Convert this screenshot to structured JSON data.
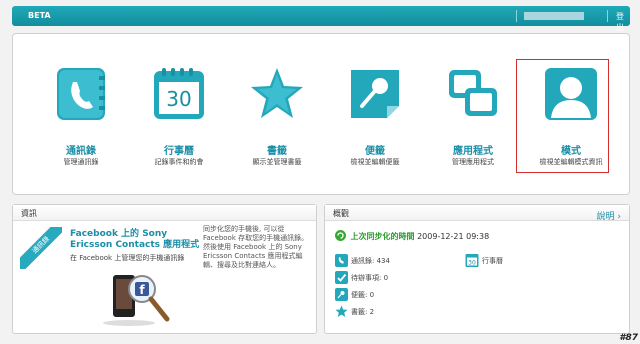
{
  "topbar": {
    "beta": "BETA",
    "logout": "登出"
  },
  "apps": [
    {
      "name": "通訊錄",
      "desc": "管理通訊錄",
      "icon": "phone-book-icon"
    },
    {
      "name": "行事曆",
      "desc": "記錄事件和約會",
      "icon": "calendar-icon",
      "day": "30"
    },
    {
      "name": "書籤",
      "desc": "顯示並管理書籤",
      "icon": "star-icon"
    },
    {
      "name": "便籤",
      "desc": "檢視並編輯便籤",
      "icon": "note-icon"
    },
    {
      "name": "應用程式",
      "desc": "管理應用程式",
      "icon": "applications-icon"
    },
    {
      "name": "模式",
      "desc": "檢視並編輯模式資訊",
      "icon": "profile-icon"
    }
  ],
  "news": {
    "header": "資訊",
    "ribbon": "通訊錄",
    "title": "Facebook 上的 Sony Ericsson Contacts 應用程式",
    "subtitle": "在 Facebook 上管理您的手機通訊錄",
    "body": "同步化您的手機後, 可以從 Facebook 存取您的手機通訊錄。然後使用 Facebook 上的 Sony Ericsson Contacts 應用程式編輯、搜尋及比對連絡人。"
  },
  "overview": {
    "header": "概觀",
    "help": "說明",
    "sync_label": "上次同步化的時間",
    "sync_time": "2009-12-21 09:38",
    "items": [
      {
        "label": "通訊錄: 434"
      },
      {
        "label": "待辦事項: 0"
      },
      {
        "label": "便籤: 0"
      },
      {
        "label": "書籤: 2"
      }
    ],
    "calendar_label": "行事曆",
    "calendar_day": "30"
  },
  "watermark": "#87",
  "colors": {
    "accent": "#1fa9b8",
    "link": "#1a8fa8",
    "selection": "#d23030"
  }
}
